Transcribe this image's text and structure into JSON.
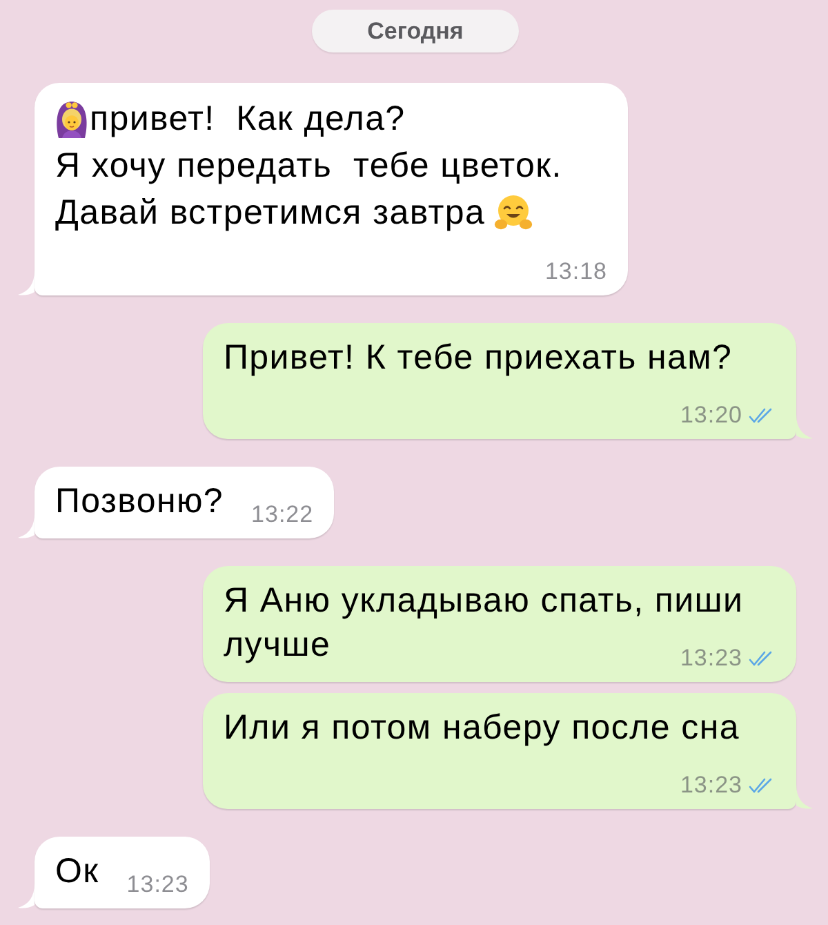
{
  "date_label": "Сегодня",
  "messages": [
    {
      "outgoing": false,
      "tail": true,
      "lines": [
        [
          {
            "kind": "woman"
          },
          {
            "kind": "text",
            "text": "привет!  Как дела?"
          }
        ],
        [
          {
            "kind": "text",
            "text": "Я хочу передать  тебе цветок."
          }
        ],
        [
          {
            "kind": "text",
            "text": "Давай встретимся завтра"
          },
          {
            "kind": "hug"
          }
        ]
      ],
      "time": "13:18"
    },
    {
      "outgoing": true,
      "tail": true,
      "lines": [
        [
          {
            "kind": "text",
            "text": "Привет! К тебе приехать нам?"
          }
        ]
      ],
      "time": "13:20",
      "read": true
    },
    {
      "outgoing": false,
      "tail": true,
      "lines": [
        [
          {
            "kind": "text",
            "text": "Позвоню?"
          }
        ]
      ],
      "time": "13:22"
    },
    {
      "outgoing": true,
      "tail": false,
      "lines": [
        [
          {
            "kind": "text",
            "text": "Я Аню укладываю спать, пиши"
          }
        ],
        [
          {
            "kind": "text",
            "text": "лучше"
          }
        ]
      ],
      "time": "13:23",
      "read": true
    },
    {
      "outgoing": true,
      "tail": true,
      "lines": [
        [
          {
            "kind": "text",
            "text": "Или я потом наберу после сна"
          }
        ]
      ],
      "time": "13:23",
      "read": true
    },
    {
      "outgoing": false,
      "tail": true,
      "lines": [
        [
          {
            "kind": "text",
            "text": "Ок"
          }
        ]
      ],
      "time": "13:23"
    }
  ]
}
